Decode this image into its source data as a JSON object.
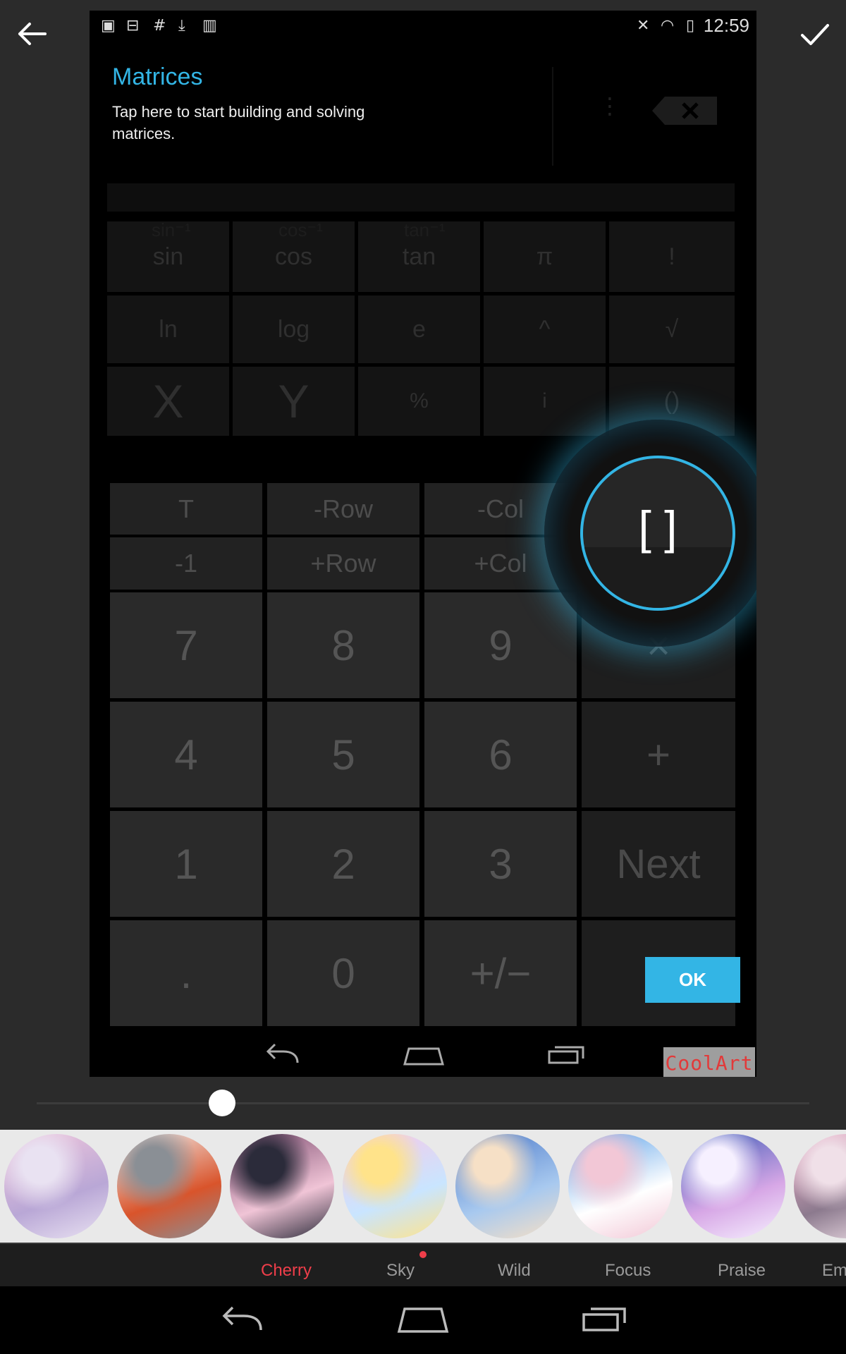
{
  "inner_status_bar": {
    "time": "12:59"
  },
  "tooltip": {
    "title": "Matrices",
    "description": "Tap here to start building and solving matrices."
  },
  "scientific_keys": {
    "row1": [
      "sin",
      "cos",
      "tan",
      "π",
      "!"
    ],
    "row1_inverse": [
      "sin⁻¹",
      "cos⁻¹",
      "tan⁻¹"
    ],
    "row2": [
      "ln",
      "log",
      "e",
      "^",
      "√"
    ],
    "row3": [
      "X",
      "Y",
      "%",
      "i",
      "()"
    ]
  },
  "matrix_keys": {
    "row1": [
      "T",
      "-Row",
      "-Col"
    ],
    "row2": [
      "-1",
      "+Row",
      "+Col"
    ]
  },
  "number_keys": {
    "row1": [
      "7",
      "8",
      "9",
      "×"
    ],
    "row2": [
      "4",
      "5",
      "6",
      "+"
    ],
    "row3": [
      "1",
      "2",
      "3",
      "Next"
    ],
    "row4": [
      ".",
      "0",
      "+/−"
    ]
  },
  "spotlight": {
    "label": "[ ]"
  },
  "ok_button": "OK",
  "watermark": "CoolArt",
  "slider": {
    "value": 0.24
  },
  "filters": [
    {
      "name": "",
      "colors": [
        "#f3c8dc",
        "#b9a7d6",
        "#e9e2f2"
      ]
    },
    {
      "name": "Cherry",
      "colors": [
        "#f2f2f2",
        "#d9542b",
        "#8a8f95"
      ]
    },
    {
      "name": "Sky",
      "colors": [
        "#7a4a6e",
        "#f0c4d6",
        "#2b2b3a"
      ]
    },
    {
      "name": "Wild",
      "colors": [
        "#f9c7e6",
        "#c9e5ff",
        "#ffe38a"
      ]
    },
    {
      "name": "Focus",
      "colors": [
        "#4c79c9",
        "#a8c9ef",
        "#f6e0c6"
      ]
    },
    {
      "name": "Praise",
      "colors": [
        "#5aa0e8",
        "#ffffff",
        "#f2c7d6"
      ]
    },
    {
      "name": "Em",
      "colors": [
        "#3b5bb7",
        "#d7a7e6",
        "#f6f0ff"
      ]
    },
    {
      "name": "",
      "colors": [
        "#f6b6d0",
        "#8c7a8e",
        "#f0e0e8"
      ]
    }
  ],
  "filter_labels": [
    "Cherry",
    "Sky",
    "Wild",
    "Focus",
    "Praise",
    "Em"
  ],
  "active_filter": "Cherry",
  "colors": {
    "accent_blue": "#33b5e5",
    "active_red": "#ef3e4a"
  }
}
